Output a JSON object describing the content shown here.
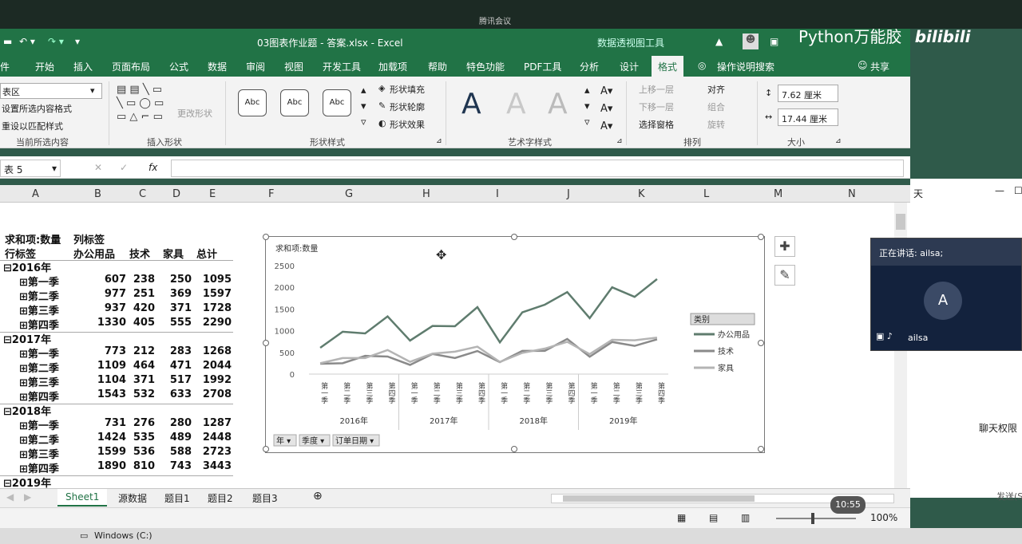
{
  "meeting": {
    "tab_label": "腾讯会议",
    "speaking_label": "正在讲话: ailsa;",
    "avatar_letter": "A",
    "participant_name": "ailsa",
    "panel_text": "天",
    "chat_text": "聊天权限",
    "send_text": "发送(S",
    "time": "10:55"
  },
  "brand": {
    "text": "Python万能胶",
    "logo": "bilibili"
  },
  "titlebar": {
    "filename": "03图表作业题 - 答案.xlsx  -  Excel",
    "context_tool": "数据透视图工具"
  },
  "menu": {
    "tabs": [
      "件",
      "开始",
      "插入",
      "页面布局",
      "公式",
      "数据",
      "审阅",
      "视图",
      "开发工具",
      "加载项",
      "帮助",
      "特色功能",
      "PDF工具",
      "分析",
      "设计",
      "格式",
      "操作说明搜索"
    ],
    "active": "格式",
    "share": "共享"
  },
  "ribbon": {
    "current_selection": {
      "dropdown": "表区",
      "format_sel": "设置所选内容格式",
      "reset": "重设以匹配样式",
      "label": "当前所选内容"
    },
    "insert_shapes": {
      "change_shape": "更改形状",
      "label": "插入形状"
    },
    "shape_styles": {
      "abc": "Abc",
      "fill": "形状填充",
      "outline": "形状轮廓",
      "effect": "形状效果",
      "label": "形状样式"
    },
    "wordart": {
      "letter": "A",
      "label": "艺术字样式"
    },
    "arrange": {
      "bring_forward": "上移一层",
      "send_backward": "下移一层",
      "selection_pane": "选择窗格",
      "align": "对齐",
      "group": "组合",
      "rotate": "旋转",
      "label": "排列"
    },
    "size": {
      "height": "7.62 厘米",
      "width": "17.44 厘米",
      "label": "大小"
    }
  },
  "formula": {
    "name_box": "表 5",
    "fx": "fx"
  },
  "columns": [
    "A",
    "B",
    "C",
    "D",
    "E",
    "F",
    "G",
    "H",
    "I",
    "J",
    "K",
    "L",
    "M",
    "N"
  ],
  "pivot": {
    "sum_label": "求和项:数量",
    "col_label": "列标签",
    "row_label": "行标签",
    "headers": [
      "办公用品",
      "技术",
      "家具",
      "总计"
    ],
    "rows": [
      {
        "label": "2016年",
        "type": "year"
      },
      {
        "label": "第一季",
        "values": [
          "607",
          "238",
          "250",
          "1095"
        ]
      },
      {
        "label": "第二季",
        "values": [
          "977",
          "251",
          "369",
          "1597"
        ]
      },
      {
        "label": "第三季",
        "values": [
          "937",
          "420",
          "371",
          "1728"
        ]
      },
      {
        "label": "第四季",
        "values": [
          "1330",
          "405",
          "555",
          "2290"
        ]
      },
      {
        "label": "2017年",
        "type": "year"
      },
      {
        "label": "第一季",
        "values": [
          "773",
          "212",
          "283",
          "1268"
        ]
      },
      {
        "label": "第二季",
        "values": [
          "1109",
          "464",
          "471",
          "2044"
        ]
      },
      {
        "label": "第三季",
        "values": [
          "1104",
          "371",
          "517",
          "1992"
        ]
      },
      {
        "label": "第四季",
        "values": [
          "1543",
          "532",
          "633",
          "2708"
        ]
      },
      {
        "label": "2018年",
        "type": "year"
      },
      {
        "label": "第一季",
        "values": [
          "731",
          "276",
          "280",
          "1287"
        ]
      },
      {
        "label": "第二季",
        "values": [
          "1424",
          "535",
          "489",
          "2448"
        ]
      },
      {
        "label": "第三季",
        "values": [
          "1599",
          "536",
          "588",
          "2723"
        ]
      },
      {
        "label": "第四季",
        "values": [
          "1890",
          "810",
          "743",
          "3443"
        ]
      },
      {
        "label": "2019年",
        "type": "year"
      }
    ]
  },
  "chart_data": {
    "type": "line",
    "title": "求和项:数量",
    "ylim": [
      0,
      2500
    ],
    "yticks": [
      0,
      500,
      1000,
      1500,
      2000,
      2500
    ],
    "quarters": [
      "第一季",
      "第二季",
      "第三季",
      "第四季",
      "第一季",
      "第二季",
      "第三季",
      "第四季",
      "第一季",
      "第二季",
      "第三季",
      "第四季",
      "第一季",
      "第二季",
      "第三季",
      "第四季"
    ],
    "years": [
      "2016年",
      "2017年",
      "2018年",
      "2019年"
    ],
    "legend_title": "类别",
    "series": [
      {
        "name": "办公用品",
        "color": "#5f7c6e",
        "values": [
          607,
          977,
          937,
          1330,
          773,
          1109,
          1104,
          1543,
          731,
          1424,
          1599,
          1890,
          1290,
          2000,
          1780,
          2190
        ]
      },
      {
        "name": "技术",
        "color": "#8a8a8a",
        "values": [
          238,
          251,
          420,
          405,
          212,
          464,
          371,
          532,
          276,
          535,
          536,
          810,
          400,
          740,
          650,
          800
        ]
      },
      {
        "name": "家具",
        "color": "#b4b4b4",
        "values": [
          250,
          369,
          371,
          555,
          283,
          471,
          517,
          633,
          280,
          489,
          588,
          743,
          460,
          790,
          780,
          840
        ]
      }
    ],
    "filters": [
      "年",
      "季度",
      "订单日期"
    ],
    "legend_position": "right"
  },
  "sheet_tabs": [
    "Sheet1",
    "源数据",
    "题目1",
    "题目2",
    "题目3"
  ],
  "active_sheet": "Sheet1",
  "status": {
    "zoom": "100%"
  },
  "taskbar": {
    "drive": "Windows (C:)"
  }
}
